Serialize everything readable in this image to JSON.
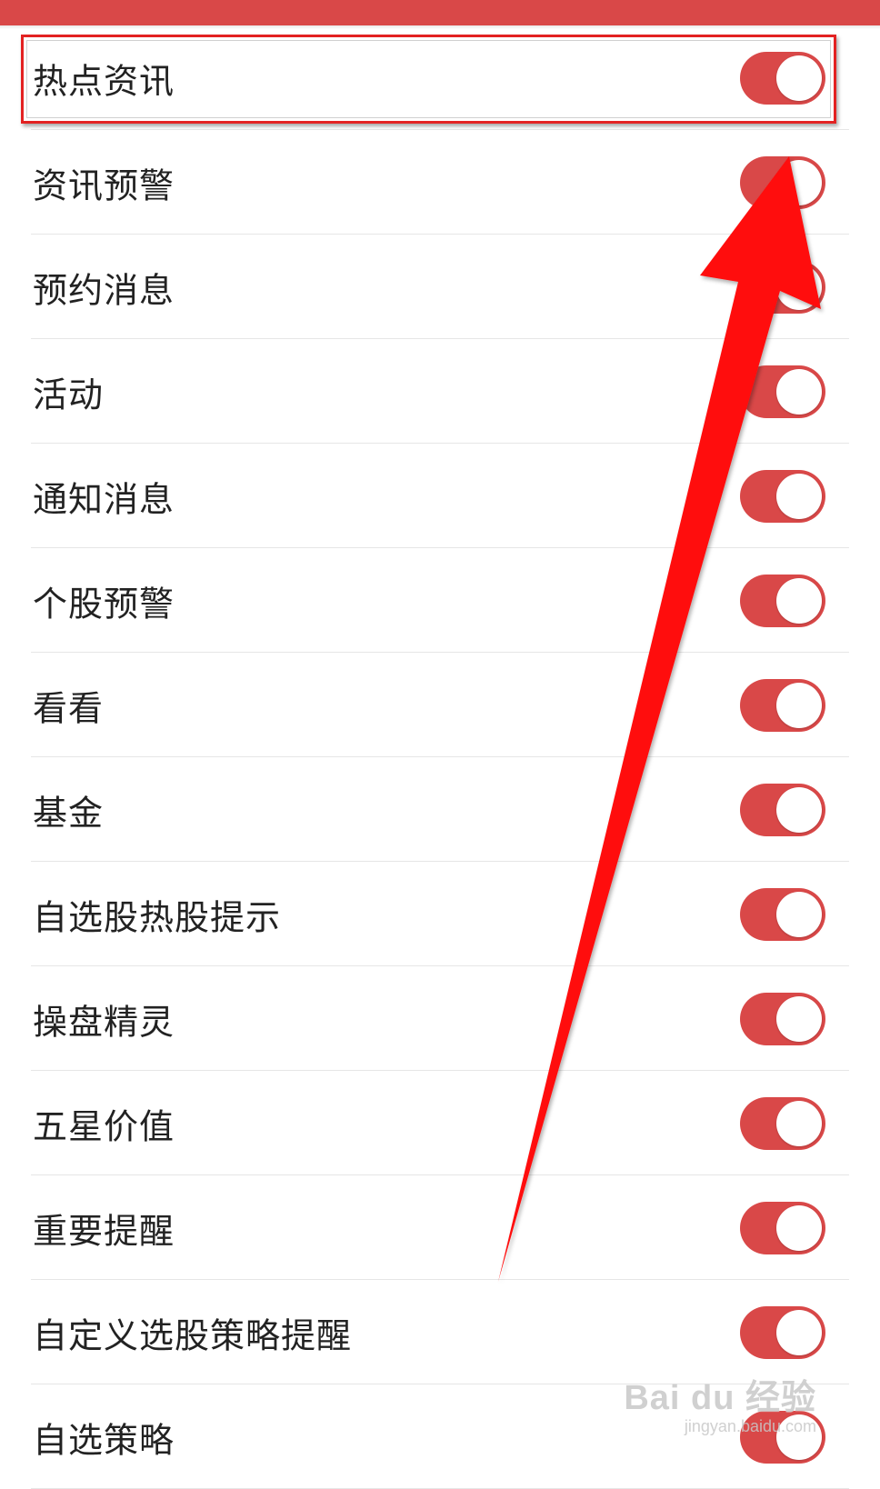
{
  "header": {
    "bar_color": "#d94848"
  },
  "settings": {
    "toggle_on_color": "#d94848",
    "items": [
      {
        "label": "热点资讯",
        "enabled": true
      },
      {
        "label": "资讯预警",
        "enabled": true
      },
      {
        "label": "预约消息",
        "enabled": true
      },
      {
        "label": "活动",
        "enabled": true
      },
      {
        "label": "通知消息",
        "enabled": true
      },
      {
        "label": "个股预警",
        "enabled": true
      },
      {
        "label": "看看",
        "enabled": true
      },
      {
        "label": "基金",
        "enabled": true
      },
      {
        "label": "自选股热股提示",
        "enabled": true
      },
      {
        "label": "操盘精灵",
        "enabled": true
      },
      {
        "label": "五星价值",
        "enabled": true
      },
      {
        "label": "重要提醒",
        "enabled": true
      },
      {
        "label": "自定义选股策略提醒",
        "enabled": true
      },
      {
        "label": "自选策略",
        "enabled": true
      }
    ]
  },
  "annotation": {
    "highlight_color": "#e32222",
    "arrow_color": "#ff1010"
  },
  "watermark": {
    "main": "Bai du 经验",
    "sub": "jingyan.baidu.com"
  }
}
